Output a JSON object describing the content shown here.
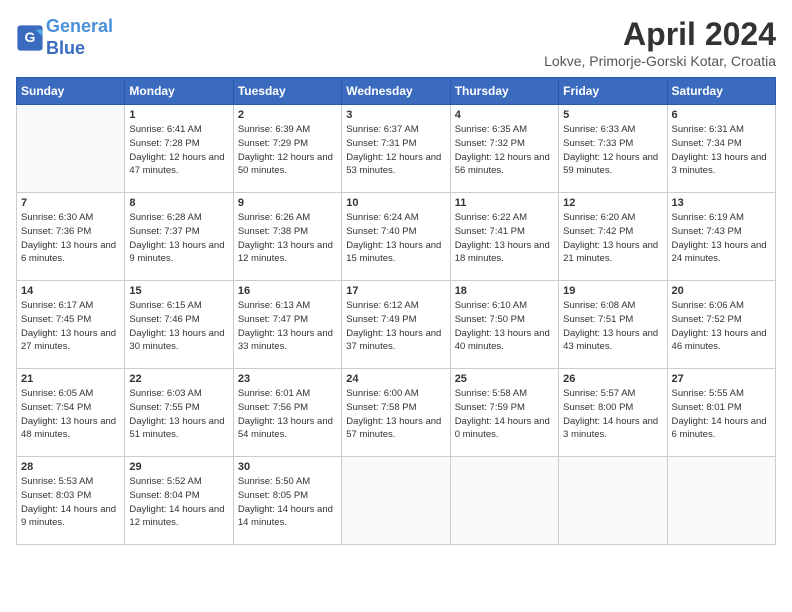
{
  "header": {
    "logo_line1": "General",
    "logo_line2": "Blue",
    "month_title": "April 2024",
    "location": "Lokve, Primorje-Gorski Kotar, Croatia"
  },
  "days_of_week": [
    "Sunday",
    "Monday",
    "Tuesday",
    "Wednesday",
    "Thursday",
    "Friday",
    "Saturday"
  ],
  "weeks": [
    [
      {
        "day": "",
        "sunrise": "",
        "sunset": "",
        "daylight": ""
      },
      {
        "day": "1",
        "sunrise": "Sunrise: 6:41 AM",
        "sunset": "Sunset: 7:28 PM",
        "daylight": "Daylight: 12 hours and 47 minutes."
      },
      {
        "day": "2",
        "sunrise": "Sunrise: 6:39 AM",
        "sunset": "Sunset: 7:29 PM",
        "daylight": "Daylight: 12 hours and 50 minutes."
      },
      {
        "day": "3",
        "sunrise": "Sunrise: 6:37 AM",
        "sunset": "Sunset: 7:31 PM",
        "daylight": "Daylight: 12 hours and 53 minutes."
      },
      {
        "day": "4",
        "sunrise": "Sunrise: 6:35 AM",
        "sunset": "Sunset: 7:32 PM",
        "daylight": "Daylight: 12 hours and 56 minutes."
      },
      {
        "day": "5",
        "sunrise": "Sunrise: 6:33 AM",
        "sunset": "Sunset: 7:33 PM",
        "daylight": "Daylight: 12 hours and 59 minutes."
      },
      {
        "day": "6",
        "sunrise": "Sunrise: 6:31 AM",
        "sunset": "Sunset: 7:34 PM",
        "daylight": "Daylight: 13 hours and 3 minutes."
      }
    ],
    [
      {
        "day": "7",
        "sunrise": "Sunrise: 6:30 AM",
        "sunset": "Sunset: 7:36 PM",
        "daylight": "Daylight: 13 hours and 6 minutes."
      },
      {
        "day": "8",
        "sunrise": "Sunrise: 6:28 AM",
        "sunset": "Sunset: 7:37 PM",
        "daylight": "Daylight: 13 hours and 9 minutes."
      },
      {
        "day": "9",
        "sunrise": "Sunrise: 6:26 AM",
        "sunset": "Sunset: 7:38 PM",
        "daylight": "Daylight: 13 hours and 12 minutes."
      },
      {
        "day": "10",
        "sunrise": "Sunrise: 6:24 AM",
        "sunset": "Sunset: 7:40 PM",
        "daylight": "Daylight: 13 hours and 15 minutes."
      },
      {
        "day": "11",
        "sunrise": "Sunrise: 6:22 AM",
        "sunset": "Sunset: 7:41 PM",
        "daylight": "Daylight: 13 hours and 18 minutes."
      },
      {
        "day": "12",
        "sunrise": "Sunrise: 6:20 AM",
        "sunset": "Sunset: 7:42 PM",
        "daylight": "Daylight: 13 hours and 21 minutes."
      },
      {
        "day": "13",
        "sunrise": "Sunrise: 6:19 AM",
        "sunset": "Sunset: 7:43 PM",
        "daylight": "Daylight: 13 hours and 24 minutes."
      }
    ],
    [
      {
        "day": "14",
        "sunrise": "Sunrise: 6:17 AM",
        "sunset": "Sunset: 7:45 PM",
        "daylight": "Daylight: 13 hours and 27 minutes."
      },
      {
        "day": "15",
        "sunrise": "Sunrise: 6:15 AM",
        "sunset": "Sunset: 7:46 PM",
        "daylight": "Daylight: 13 hours and 30 minutes."
      },
      {
        "day": "16",
        "sunrise": "Sunrise: 6:13 AM",
        "sunset": "Sunset: 7:47 PM",
        "daylight": "Daylight: 13 hours and 33 minutes."
      },
      {
        "day": "17",
        "sunrise": "Sunrise: 6:12 AM",
        "sunset": "Sunset: 7:49 PM",
        "daylight": "Daylight: 13 hours and 37 minutes."
      },
      {
        "day": "18",
        "sunrise": "Sunrise: 6:10 AM",
        "sunset": "Sunset: 7:50 PM",
        "daylight": "Daylight: 13 hours and 40 minutes."
      },
      {
        "day": "19",
        "sunrise": "Sunrise: 6:08 AM",
        "sunset": "Sunset: 7:51 PM",
        "daylight": "Daylight: 13 hours and 43 minutes."
      },
      {
        "day": "20",
        "sunrise": "Sunrise: 6:06 AM",
        "sunset": "Sunset: 7:52 PM",
        "daylight": "Daylight: 13 hours and 46 minutes."
      }
    ],
    [
      {
        "day": "21",
        "sunrise": "Sunrise: 6:05 AM",
        "sunset": "Sunset: 7:54 PM",
        "daylight": "Daylight: 13 hours and 48 minutes."
      },
      {
        "day": "22",
        "sunrise": "Sunrise: 6:03 AM",
        "sunset": "Sunset: 7:55 PM",
        "daylight": "Daylight: 13 hours and 51 minutes."
      },
      {
        "day": "23",
        "sunrise": "Sunrise: 6:01 AM",
        "sunset": "Sunset: 7:56 PM",
        "daylight": "Daylight: 13 hours and 54 minutes."
      },
      {
        "day": "24",
        "sunrise": "Sunrise: 6:00 AM",
        "sunset": "Sunset: 7:58 PM",
        "daylight": "Daylight: 13 hours and 57 minutes."
      },
      {
        "day": "25",
        "sunrise": "Sunrise: 5:58 AM",
        "sunset": "Sunset: 7:59 PM",
        "daylight": "Daylight: 14 hours and 0 minutes."
      },
      {
        "day": "26",
        "sunrise": "Sunrise: 5:57 AM",
        "sunset": "Sunset: 8:00 PM",
        "daylight": "Daylight: 14 hours and 3 minutes."
      },
      {
        "day": "27",
        "sunrise": "Sunrise: 5:55 AM",
        "sunset": "Sunset: 8:01 PM",
        "daylight": "Daylight: 14 hours and 6 minutes."
      }
    ],
    [
      {
        "day": "28",
        "sunrise": "Sunrise: 5:53 AM",
        "sunset": "Sunset: 8:03 PM",
        "daylight": "Daylight: 14 hours and 9 minutes."
      },
      {
        "day": "29",
        "sunrise": "Sunrise: 5:52 AM",
        "sunset": "Sunset: 8:04 PM",
        "daylight": "Daylight: 14 hours and 12 minutes."
      },
      {
        "day": "30",
        "sunrise": "Sunrise: 5:50 AM",
        "sunset": "Sunset: 8:05 PM",
        "daylight": "Daylight: 14 hours and 14 minutes."
      },
      {
        "day": "",
        "sunrise": "",
        "sunset": "",
        "daylight": ""
      },
      {
        "day": "",
        "sunrise": "",
        "sunset": "",
        "daylight": ""
      },
      {
        "day": "",
        "sunrise": "",
        "sunset": "",
        "daylight": ""
      },
      {
        "day": "",
        "sunrise": "",
        "sunset": "",
        "daylight": ""
      }
    ]
  ]
}
